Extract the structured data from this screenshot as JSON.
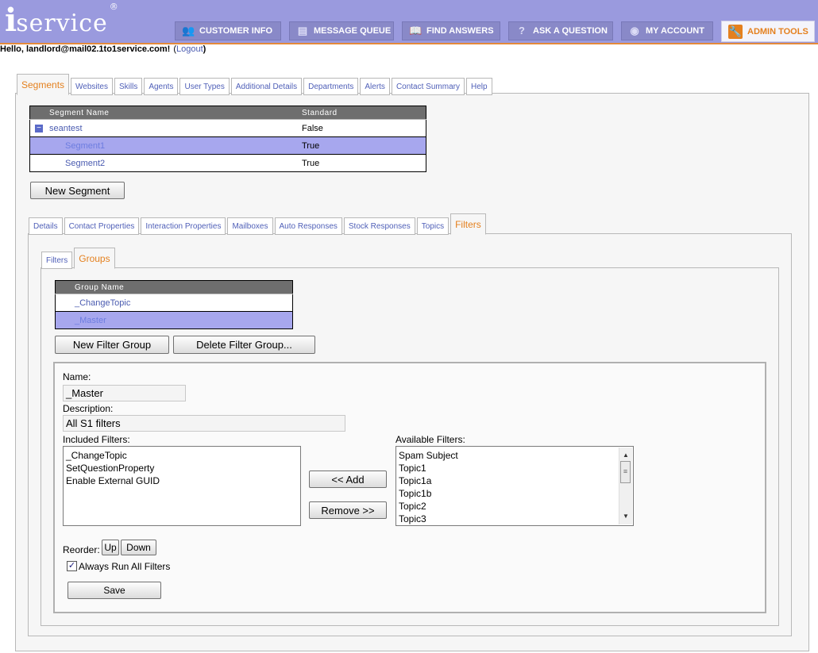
{
  "app": {
    "logo_text": "service",
    "logo_i": "i",
    "logo_reg": "®"
  },
  "nav": [
    {
      "label": "CUSTOMER INFO",
      "icon": "people-icon"
    },
    {
      "label": "MESSAGE QUEUE",
      "icon": "document-icon"
    },
    {
      "label": "FIND ANSWERS",
      "icon": "book-icon"
    },
    {
      "label": "ASK A QUESTION",
      "icon": "question-icon"
    },
    {
      "label": "MY ACCOUNT",
      "icon": "eye-icon"
    },
    {
      "label": "ADMIN TOOLS",
      "icon": "wrench-icon",
      "active": true
    }
  ],
  "greeting": {
    "text": "Hello, landlord@mail02.1to1service.com!",
    "logout": "Logout",
    "open_paren": "(",
    "close_paren": ")"
  },
  "main_tabs": [
    "Segments",
    "Websites",
    "Skills",
    "Agents",
    "User Types",
    "Additional Details",
    "Departments",
    "Alerts",
    "Contact Summary",
    "Help"
  ],
  "segments_table": {
    "headers": [
      "Segment Name",
      "Standard"
    ],
    "rows": [
      {
        "name": "seantest",
        "standard": "False",
        "expander": "−"
      },
      {
        "name": "Segment1",
        "standard": "True",
        "selected": true
      },
      {
        "name": "Segment2",
        "standard": "True"
      }
    ]
  },
  "new_segment_label": "New Segment",
  "segment_tabs": [
    "Details",
    "Contact Properties",
    "Interaction Properties",
    "Mailboxes",
    "Auto Responses",
    "Stock Responses",
    "Topics",
    "Filters"
  ],
  "filter_tabs": [
    "Filters",
    "Groups"
  ],
  "groups_table": {
    "header": "Group Name",
    "rows": [
      {
        "name": "_ChangeTopic"
      },
      {
        "name": "_Master",
        "selected": true
      }
    ]
  },
  "group_buttons": {
    "new": "New Filter Group",
    "delete": "Delete Filter Group..."
  },
  "form": {
    "name_label": "Name:",
    "name_value": "_Master",
    "description_label": "Description:",
    "description_value": "All S1 filters",
    "included_label": "Included Filters:",
    "included": [
      "_ChangeTopic",
      "SetQuestionProperty",
      "Enable External GUID"
    ],
    "available_label": "Available Filters:",
    "available": [
      "Spam Subject",
      "Topic1",
      "Topic1a",
      "Topic1b",
      "Topic2",
      "Topic3"
    ],
    "add_label": "<< Add",
    "remove_label": "Remove >>",
    "reorder_label": "Reorder:",
    "up_label": "Up",
    "down_label": "Down",
    "always_run_label": "Always Run All Filters",
    "always_run_checked": true,
    "save_label": "Save"
  },
  "colors": {
    "header_bg": "#9a9ade",
    "accent": "#e4801e",
    "link": "#4a5bb0",
    "selected_row": "#a7a7ee"
  }
}
